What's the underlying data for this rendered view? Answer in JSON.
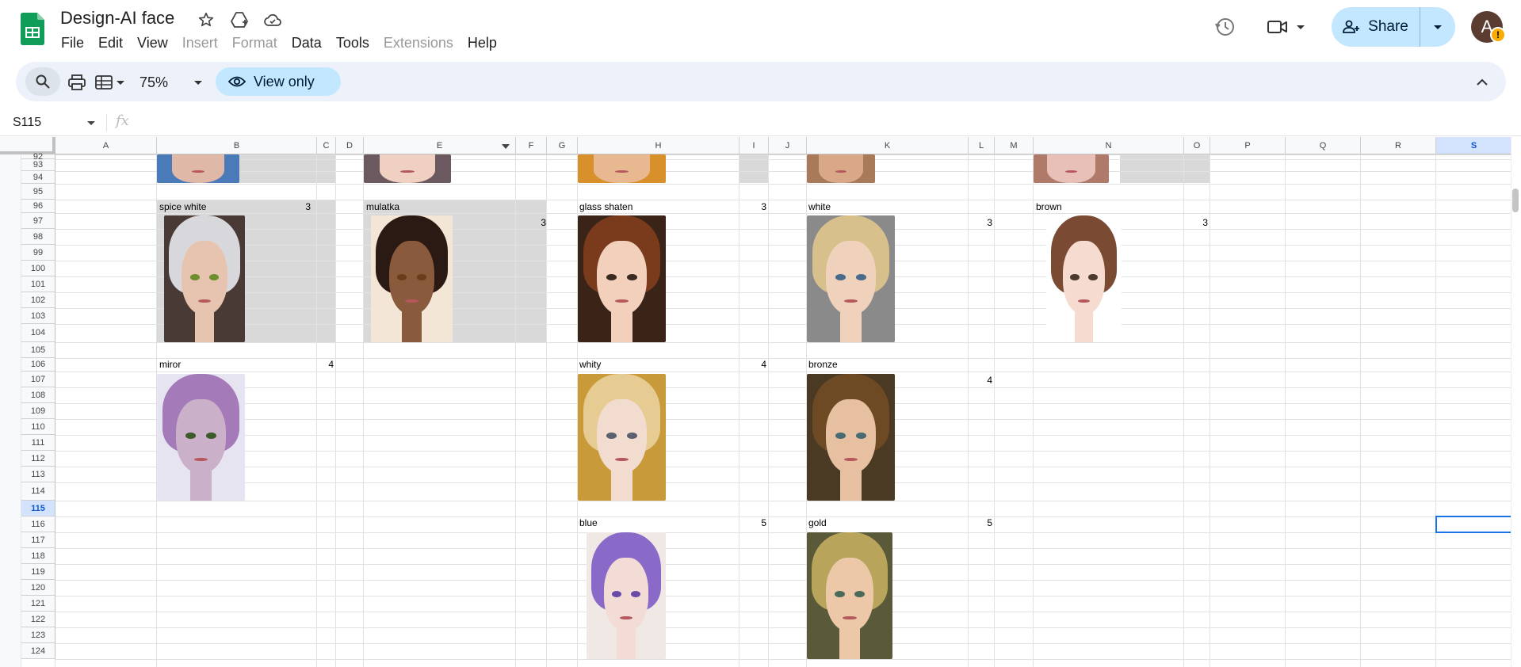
{
  "doc": {
    "title": "Design-AI face"
  },
  "menu": [
    {
      "label": "File",
      "disabled": false
    },
    {
      "label": "Edit",
      "disabled": false
    },
    {
      "label": "View",
      "disabled": false
    },
    {
      "label": "Insert",
      "disabled": true
    },
    {
      "label": "Format",
      "disabled": true
    },
    {
      "label": "Data",
      "disabled": false
    },
    {
      "label": "Tools",
      "disabled": false
    },
    {
      "label": "Extensions",
      "disabled": true
    },
    {
      "label": "Help",
      "disabled": false
    }
  ],
  "header": {
    "share_label": "Share",
    "avatar_initial": "A",
    "avatar_warning": "!"
  },
  "toolbar": {
    "zoom": "75%",
    "view_only_label": "View only"
  },
  "formula_bar": {
    "cell_ref": "S115",
    "fx_label": "fx"
  },
  "columns": [
    "A",
    "B",
    "C",
    "D",
    "E",
    "F",
    "G",
    "H",
    "I",
    "J",
    "K",
    "L",
    "M",
    "N",
    "O",
    "P",
    "Q",
    "R",
    "S"
  ],
  "rows": [
    "92",
    "93",
    "94",
    "95",
    "96",
    "97",
    "98",
    "99",
    "100",
    "101",
    "102",
    "103",
    "104",
    "105",
    "106",
    "107",
    "108",
    "109",
    "110",
    "111",
    "112",
    "113",
    "114",
    "115",
    "116",
    "117",
    "118",
    "119",
    "120",
    "121",
    "122",
    "123",
    "124"
  ],
  "selected": {
    "column": "S",
    "row": "115"
  },
  "cells": {
    "b95": "spice white",
    "c95": "3",
    "e95": "mulatka",
    "f96": "3",
    "h95": "glass shaten",
    "i95": "3",
    "k95": "white",
    "l96": "3",
    "n95": "brown",
    "o96": "3",
    "b105": "miror",
    "c105": "4",
    "h105": "whity",
    "i105": "4",
    "k105": "bronze",
    "l106": "4",
    "h115": "blue",
    "i115": "5",
    "k115": "gold",
    "l115": "5"
  },
  "images": [
    {
      "name": "face-spice-white",
      "hair": "#d8d8dc",
      "skin": "#e7c4b0",
      "bg": "#4a3a36",
      "eye": "#6e8f2e"
    },
    {
      "name": "face-mulatka",
      "hair": "#2b1a14",
      "skin": "#8a5a3c",
      "bg": "#f3e6d6",
      "eye": "#6a3c1c"
    },
    {
      "name": "face-glass-shaten",
      "hair": "#7a3b1c",
      "skin": "#f2d0bc",
      "bg": "#3a2418",
      "eye": "#3b2a20"
    },
    {
      "name": "face-white",
      "hair": "#d8c08c",
      "skin": "#f0d2bc",
      "bg": "#8a8a8a",
      "eye": "#4a6a8a"
    },
    {
      "name": "face-brown",
      "hair": "#7a4a32",
      "skin": "#f6dcd0",
      "bg": "#ffffff",
      "eye": "#4a3a30"
    },
    {
      "name": "face-miror",
      "hair": "#a47ab8",
      "skin": "#cab0c8",
      "bg": "#e6e4f0",
      "eye": "#3d5a2a"
    },
    {
      "name": "face-whity",
      "hair": "#e6cc92",
      "skin": "#f2dcd0",
      "bg": "#c89a3a",
      "eye": "#5a6070"
    },
    {
      "name": "face-bronze",
      "hair": "#6e4a24",
      "skin": "#e6c0a0",
      "bg": "#4a3a24",
      "eye": "#4a6a74"
    },
    {
      "name": "face-blue",
      "hair": "#8a6ac8",
      "skin": "#f4dcd6",
      "bg": "#f0e8e4",
      "eye": "#6a4aa8"
    },
    {
      "name": "face-gold",
      "hair": "#b8a45a",
      "skin": "#ecc8a8",
      "bg": "#5a5a3a",
      "eye": "#4a6a5a"
    }
  ],
  "colors": {
    "share_bg": "#c2e7ff",
    "toolbar_bg": "#edf2fa",
    "selection": "#1a73e8",
    "sheets_green": "#0f9d58"
  }
}
